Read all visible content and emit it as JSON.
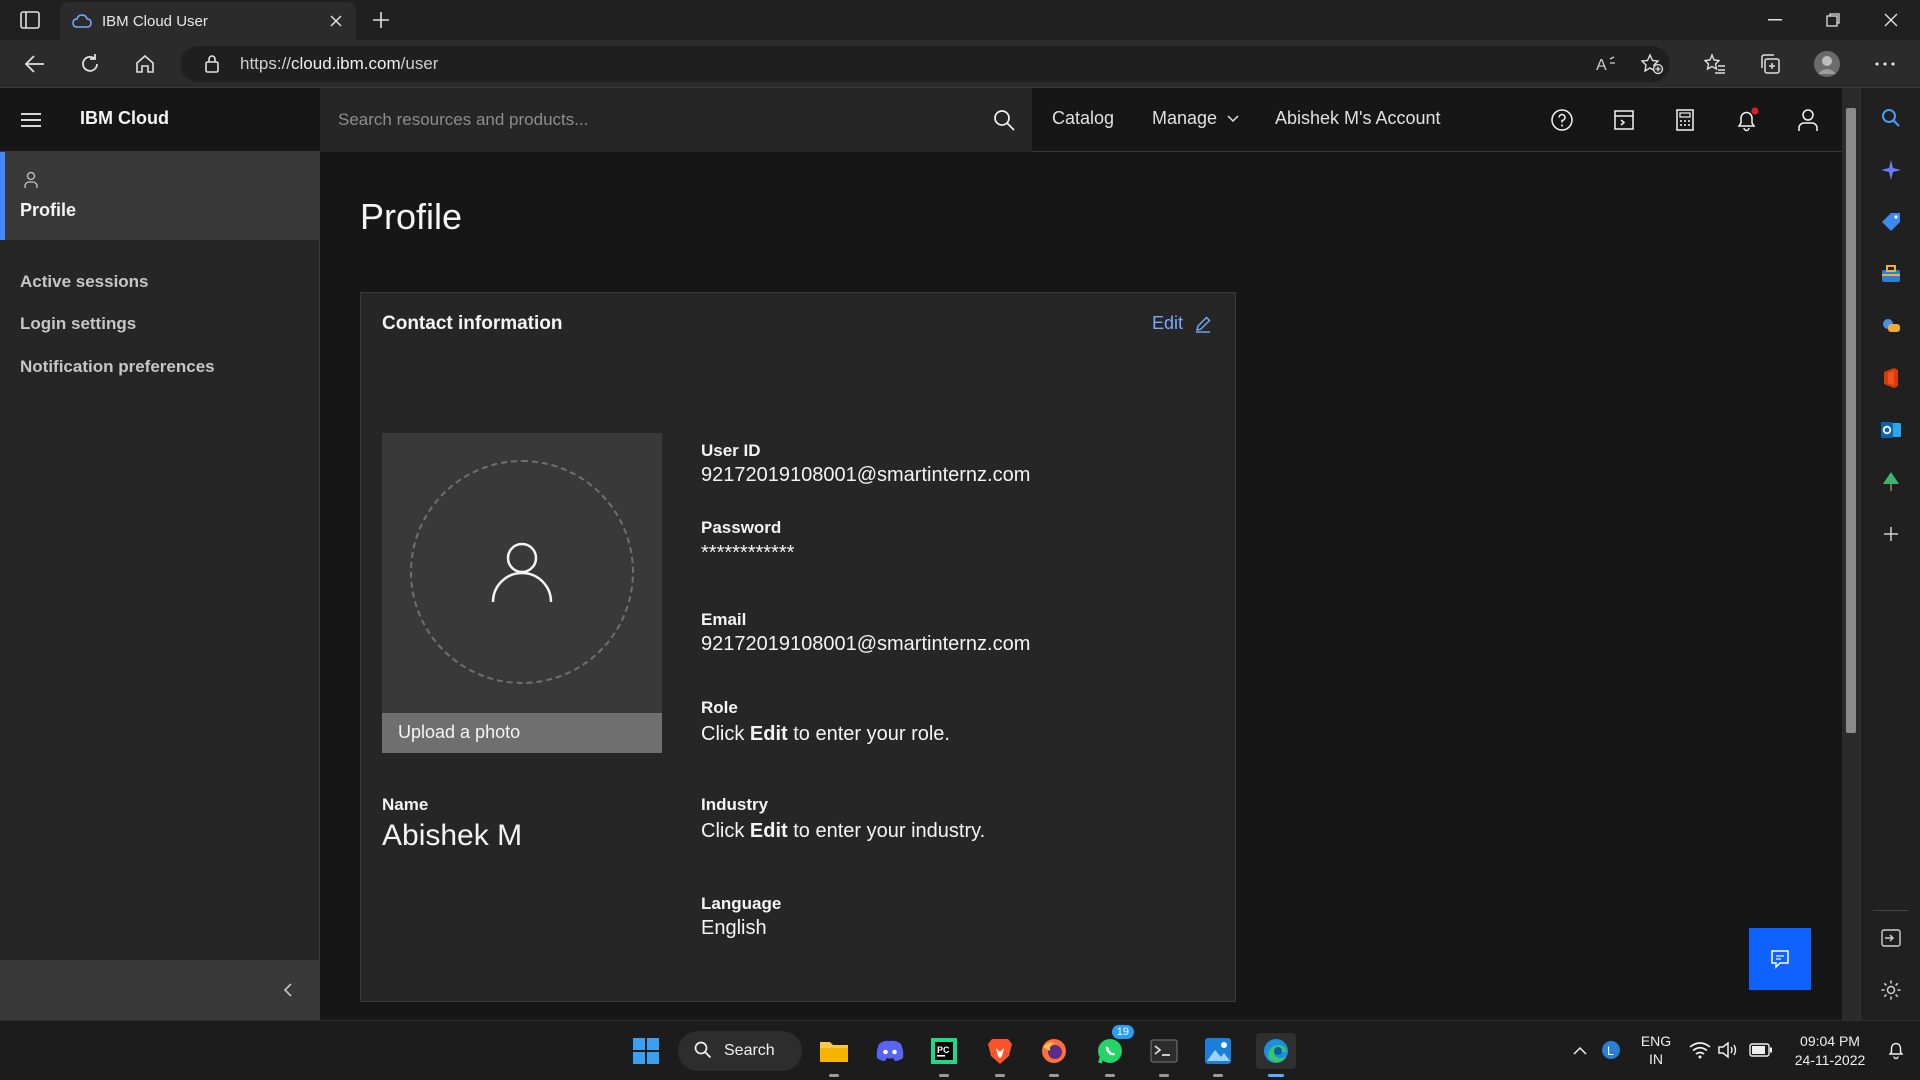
{
  "browser": {
    "tab_title": "IBM Cloud User",
    "url_prefix": "https://",
    "url_host": "cloud.ibm.com",
    "url_path": "/user"
  },
  "header": {
    "brand": "IBM Cloud",
    "search_placeholder": "Search resources and products...",
    "catalog": "Catalog",
    "manage": "Manage",
    "account": "Abishek M's Account"
  },
  "sidebar": {
    "active": "Profile",
    "items": [
      {
        "label": "Active sessions"
      },
      {
        "label": "Login settings"
      },
      {
        "label": "Notification preferences"
      }
    ]
  },
  "main": {
    "title": "Profile",
    "card_title": "Contact information",
    "edit_label": "Edit",
    "upload_label": "Upload a photo",
    "name_label": "Name",
    "name_value": "Abishek M",
    "fields": {
      "user_id": {
        "label": "User ID",
        "value": "92172019108001@smartinternz.com"
      },
      "password": {
        "label": "Password",
        "value": "************"
      },
      "email": {
        "label": "Email",
        "value": "92172019108001@smartinternz.com"
      },
      "role": {
        "label": "Role",
        "pre": "Click ",
        "bold": "Edit",
        "post": " to enter your role."
      },
      "industry": {
        "label": "Industry",
        "pre": "Click ",
        "bold": "Edit",
        "post": " to enter your industry."
      },
      "language": {
        "label": "Language",
        "value": "English"
      }
    }
  },
  "taskbar": {
    "search_label": "Search",
    "whatsapp_badge": "19",
    "lang_top": "ENG",
    "lang_bottom": "IN",
    "time": "09:04 PM",
    "date": "24-11-2022"
  },
  "colors": {
    "accent": "#4589ff",
    "link": "#78a9ff",
    "chat_button": "#0f62fe"
  }
}
